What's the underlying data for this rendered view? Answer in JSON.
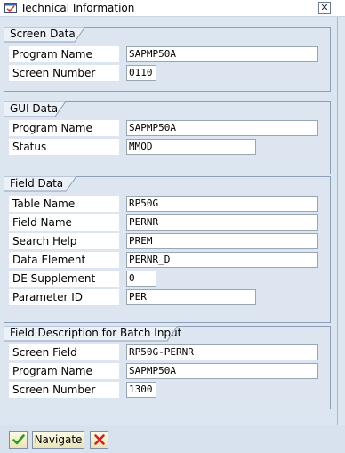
{
  "window": {
    "title": "Technical Information",
    "close_glyph": "✕"
  },
  "groups": {
    "screen_data": {
      "title": "Screen Data",
      "rows": [
        {
          "label": "Program Name",
          "value": "SAPMP50A"
        },
        {
          "label": "Screen Number",
          "value": "0110"
        }
      ]
    },
    "gui_data": {
      "title": "GUI Data",
      "rows": [
        {
          "label": "Program Name",
          "value": "SAPMP50A"
        },
        {
          "label": "Status",
          "value": "MMOD"
        }
      ]
    },
    "field_data": {
      "title": "Field Data",
      "rows": [
        {
          "label": "Table Name",
          "value": "RP50G"
        },
        {
          "label": "Field Name",
          "value": "PERNR"
        },
        {
          "label": "Search Help",
          "value": "PREM"
        },
        {
          "label": "Data Element",
          "value": "PERNR_D"
        },
        {
          "label": "DE Supplement",
          "value": "0"
        },
        {
          "label": "Parameter ID",
          "value": "PER"
        }
      ]
    },
    "batch_input": {
      "title": "Field Description for Batch Input",
      "rows": [
        {
          "label": "Screen Field",
          "value": "RP50G-PERNR"
        },
        {
          "label": "Program Name",
          "value": "SAPMP50A"
        },
        {
          "label": "Screen Number",
          "value": "1300"
        }
      ]
    }
  },
  "footer": {
    "confirm_icon": "green-checkmark-icon",
    "navigate_label": "Navigate",
    "cancel_icon": "red-x-icon"
  },
  "colors": {
    "background": "#dce6f1",
    "group_border": "#8d9fb6",
    "tab_fill": "#ecf1f8",
    "confirm_green": "#2f9a1c",
    "cancel_red": "#d2231c",
    "button_fill": "#f6f1d2"
  }
}
